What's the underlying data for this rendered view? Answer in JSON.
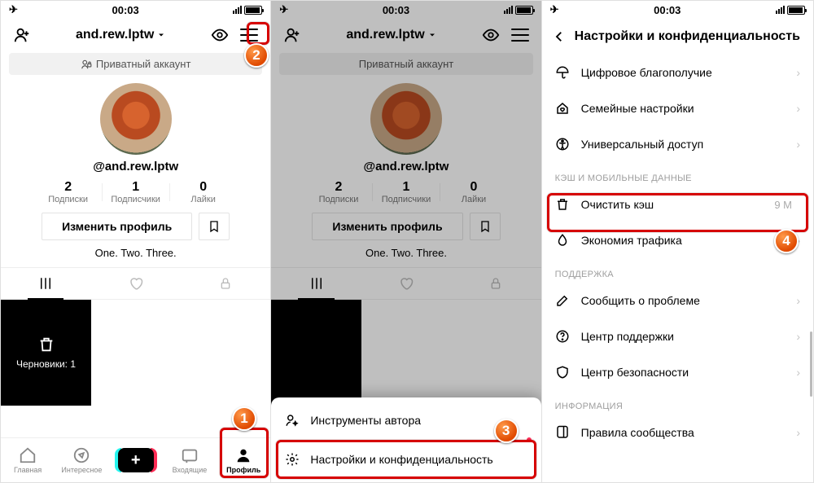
{
  "statusbar": {
    "time": "00:03"
  },
  "profile": {
    "username_title": "and.rew.lptw",
    "private_label": "Приватный аккаунт",
    "handle": "@and.rew.lptw",
    "stats": {
      "following": {
        "n": "2",
        "lbl": "Подписки"
      },
      "followers": {
        "n": "1",
        "lbl": "Подписчики"
      },
      "likes": {
        "n": "0",
        "lbl": "Лайки"
      }
    },
    "edit_button": "Изменить профиль",
    "bio": "One. Two. Three.",
    "drafts_label": "Черновики: 1"
  },
  "bottomnav": {
    "home": "Главная",
    "discover": "Интересное",
    "inbox": "Входящие",
    "profile": "Профиль"
  },
  "sheet": {
    "creator_tools": "Инструменты автора",
    "settings_privacy": "Настройки и конфиденциальность"
  },
  "settings": {
    "title": "Настройки и конфиденциальность",
    "items": {
      "wellbeing": "Цифровое благополучие",
      "family": "Семейные настройки",
      "accessibility": "Универсальный доступ",
      "clear_cache": "Очистить кэш",
      "clear_cache_value": "9 M",
      "data_saver": "Экономия трафика",
      "report": "Сообщить о проблеме",
      "help": "Центр поддержки",
      "safety": "Центр безопасности",
      "guidelines": "Правила сообщества"
    },
    "sections": {
      "cache": "КЭШ И МОБИЛЬНЫЕ ДАННЫЕ",
      "support": "ПОДДЕРЖКА",
      "info": "ИНФОРМАЦИЯ"
    }
  },
  "steps": {
    "s1": "1",
    "s2": "2",
    "s3": "3",
    "s4": "4"
  }
}
